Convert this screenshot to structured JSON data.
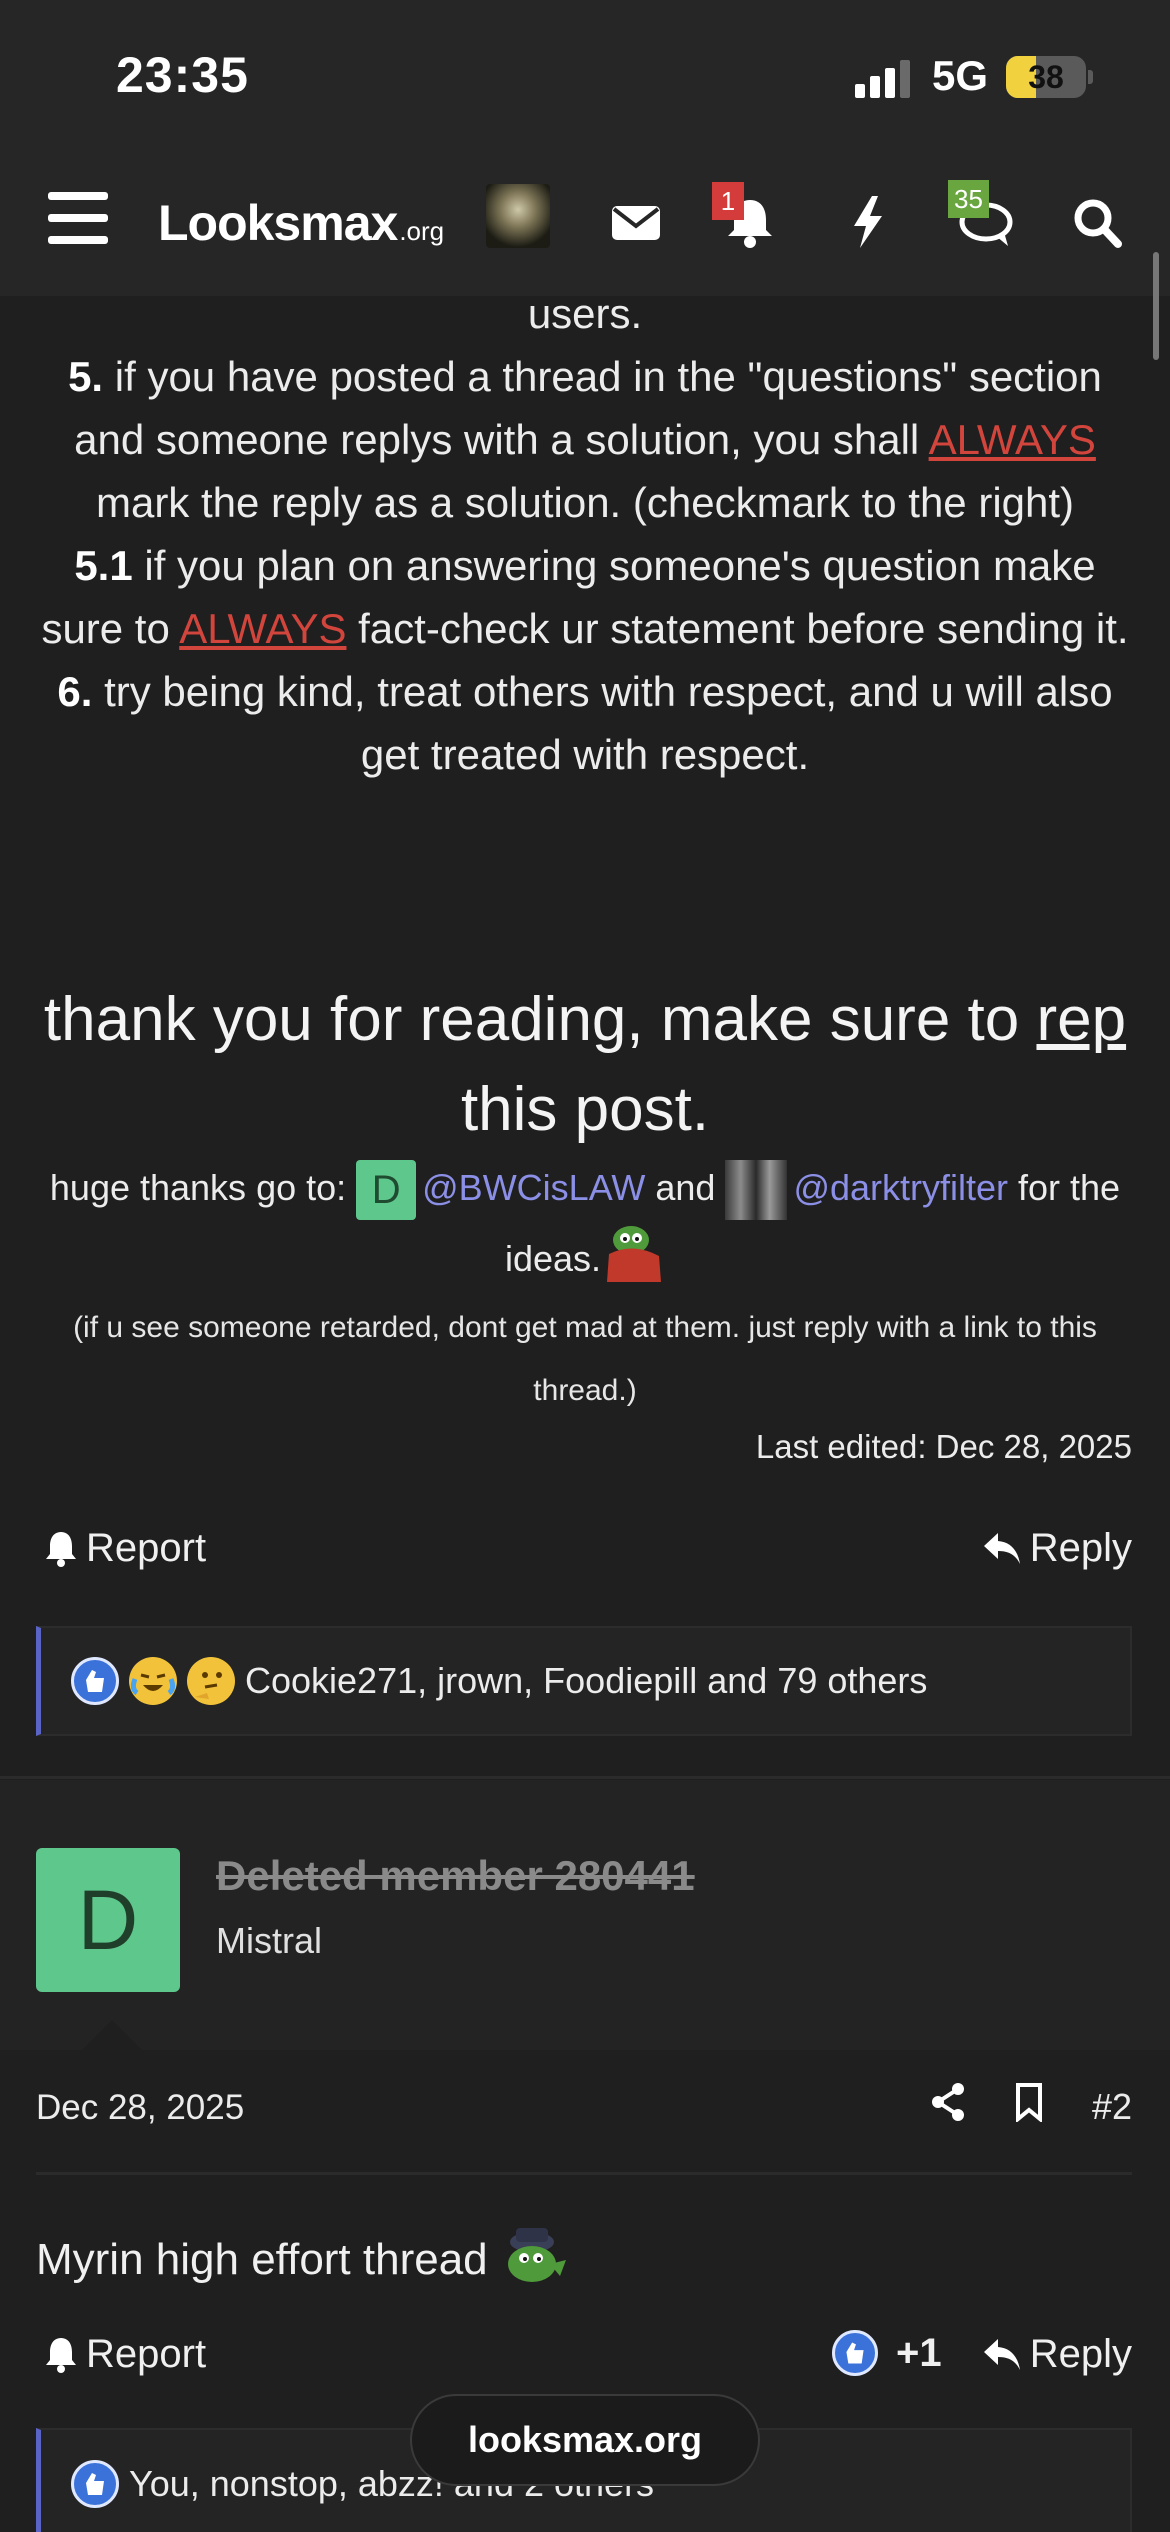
{
  "status_bar": {
    "time": "23:35",
    "network": "5G",
    "battery": "38",
    "battery_level": 0.38
  },
  "nav": {
    "logo_main": "Looksmax",
    "logo_suffix": ".org",
    "alerts_badge": "1",
    "conversations_badge": "35",
    "icons": [
      "menu-icon",
      "inbox-icon",
      "bell-icon",
      "bolt-icon",
      "chat-icon",
      "search-icon"
    ]
  },
  "post1": {
    "users_line": "users.",
    "rule5_num": "5.",
    "rule5_a": " if you have posted a thread in the \"questions\" section and someone replys with a solution, you shall ",
    "rule5_always": "ALWAYS",
    "rule5_b": " mark the reply as a solution. (checkmark to the right)",
    "rule51_num": "5.1",
    "rule51_a": " if you plan on answering someone's question make sure to ",
    "rule51_always": "ALWAYS",
    "rule51_b": " fact-check ur statement before sending it.",
    "rule6_num": "6.",
    "rule6_text": " try being kind, treat others with respect, and u will also get treated with respect.",
    "big_a": "thank you for reading, make sure to ",
    "big_rep": "rep",
    "big_b": " this post.",
    "thanks_prefix": "huge thanks go to: ",
    "mention1_avatar": "D",
    "mention1": "@BWCisLAW",
    "thanks_and": " and ",
    "mention2": "@darktryfilter",
    "thanks_suffix": " for the ideas.",
    "note": "(if u see someone retarded, dont get mad at them. just reply with a link to this thread.)",
    "last_edited": "Last edited: Dec 28, 2025",
    "report": "Report",
    "reply": "Reply",
    "reactions_text": "Cookie271, jrown, Foodiepill and 79 others"
  },
  "post2": {
    "avatar_letter": "D",
    "username": "Deleted member 280441",
    "user_title": "Mistral",
    "date": "Dec 28, 2025",
    "post_number": "#2",
    "message": "Myrin high effort thread",
    "report": "Report",
    "like_count": "+1",
    "reply": "Reply",
    "reactions_text": "You, nonstop, abzz! and 2 others"
  },
  "url_bar": {
    "domain": "looksmax.org"
  },
  "colors": {
    "background": "#1f1f1f",
    "header": "#262626",
    "accent": "#5a64c7",
    "warning": "#d2453d",
    "mention": "#8b8fe6",
    "avatar_green": "#5ec78c"
  }
}
